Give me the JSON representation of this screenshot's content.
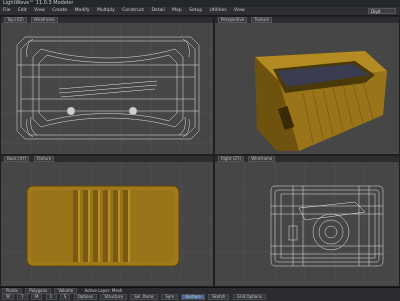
{
  "app": {
    "title": "LightWave™ 11.0.3 Modeler"
  },
  "menu": {
    "items": [
      "File",
      "Edit",
      "View",
      "Create",
      "Modify",
      "Multiply",
      "Construct",
      "Detail",
      "Map",
      "Setup",
      "Utilities",
      "View"
    ],
    "right_select": "Digit"
  },
  "viewports": {
    "top_left": {
      "view": "Top (XZ)",
      "mode": "Wireframe"
    },
    "top_right": {
      "view": "Perspective",
      "mode": "Texture"
    },
    "bottom_left": {
      "view": "Back (XY)",
      "mode": "Texture"
    },
    "bottom_right": {
      "view": "Right (ZY)",
      "mode": "Wireframe"
    }
  },
  "status": {
    "row1": [
      "Points",
      "Polygons",
      "Volume",
      "Active Layer: Mesh"
    ],
    "row2": [
      "W",
      "T",
      "M",
      "C",
      "S",
      "Options",
      "Structure",
      "Sel. Items",
      "Sym",
      "Surface",
      "Sketch",
      "Grid Options"
    ],
    "selected": "Surface"
  },
  "colors": {
    "body": "#a07a1a",
    "body_dark": "#6e520d",
    "insert": "#3a3c52",
    "wire": "#e6e6e6",
    "viewport_bg": "#464646",
    "grid": "#525252"
  }
}
